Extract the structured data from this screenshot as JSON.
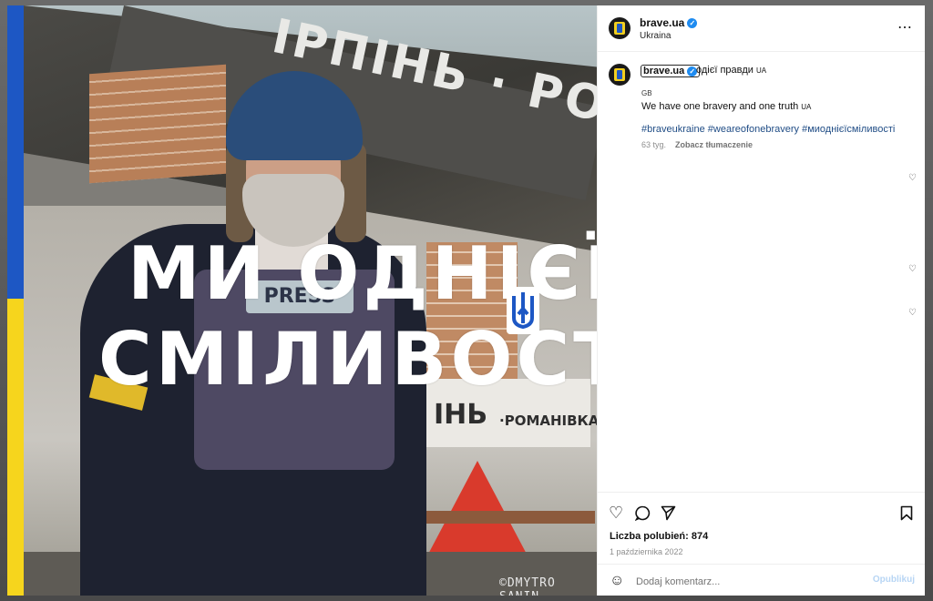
{
  "photo": {
    "sign_text": "ІРПІНЬ · РОМАН",
    "headline_line1": "МИ ОДНІЄЇ",
    "headline_line2": "СМІЛИВОСТІ",
    "vest_label": "PRESS",
    "wall_sign_big": "ІНЬ",
    "wall_sign_small": "·РОМАНІВКА",
    "credit": "©DMYTRO SANIN"
  },
  "post": {
    "username": "brave.ua",
    "location": "Ukraina",
    "more_icon": "⋯",
    "caption": {
      "username": "brave.ua",
      "text": "одієї правди",
      "lang_tag": "UA",
      "source_lang": "GB",
      "translation": "We have one bravery and one truth",
      "translation_tag": "UA",
      "hashtags": "#braveukraine #weareofonebravery #миоднієїсміливості",
      "age": "63 tyg.",
      "translate_link": "Zobacz tłumaczenie"
    },
    "likes": "Liczba polubień: 874",
    "date": "1 października 2022",
    "comment_placeholder": "Dodaj komentarz...",
    "publish_label": "Opublikuj"
  },
  "icons": {
    "verified": "✓",
    "heart": "♡",
    "comment": "◯",
    "share": "➢",
    "bookmark": "▯",
    "emoji": "☺"
  },
  "colors": {
    "flag_blue": "#1d57c4",
    "flag_yellow": "#f6d51d",
    "hashtag": "#1f4c85",
    "verified": "#1e8bf0"
  }
}
